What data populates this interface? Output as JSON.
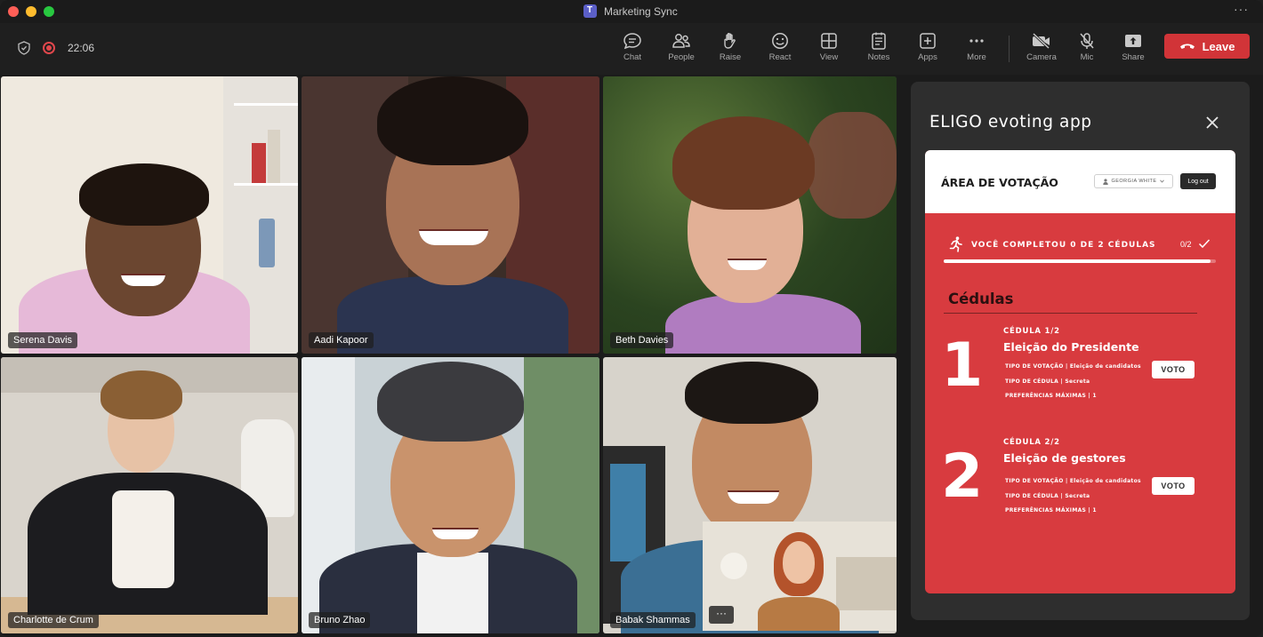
{
  "window": {
    "title": "Marketing Sync",
    "more_label": "···"
  },
  "toolbar": {
    "timer": "22:06",
    "buttons": [
      {
        "label": "Chat",
        "icon": "chat-icon"
      },
      {
        "label": "People",
        "icon": "people-icon"
      },
      {
        "label": "Raise",
        "icon": "raise-hand-icon"
      },
      {
        "label": "React",
        "icon": "react-icon"
      },
      {
        "label": "View",
        "icon": "view-icon"
      },
      {
        "label": "Notes",
        "icon": "notes-icon"
      },
      {
        "label": "Apps",
        "icon": "apps-icon"
      },
      {
        "label": "More",
        "icon": "more-icon"
      },
      {
        "label": "Camera",
        "icon": "camera-off-icon"
      },
      {
        "label": "Mic",
        "icon": "mic-off-icon"
      },
      {
        "label": "Share",
        "icon": "share-icon"
      }
    ],
    "leave_label": "Leave",
    "leave_color": "#d13438"
  },
  "participants": [
    {
      "name": "Serena Davis"
    },
    {
      "name": "Aadi Kapoor"
    },
    {
      "name": "Beth Davies"
    },
    {
      "name": "Charlotte de Crum"
    },
    {
      "name": "Bruno Zhao"
    },
    {
      "name": "Babak Shammas"
    }
  ],
  "tile_more_label": "···",
  "panel": {
    "title": "ELIGO evoting app",
    "app": {
      "header_title": "ÁREA DE VOTAÇÃO",
      "user": "GEORGIA WHITE",
      "logout_label": "Log out",
      "progress_text": "VOCÊ COMPLETOU 0 DE 2 CÉDULAS",
      "progress_count": "0/2",
      "progress_fraction": 0.98,
      "section_title": "Cédulas",
      "accent_color": "#d83b3f",
      "ballots": [
        {
          "number": "1",
          "tag": "CÉDULA 1/2",
          "title": "Eleição do Presidente",
          "vote_type": "TIPO DE VOTAÇÃO | Eleição de candidatos",
          "ballot_type": "TIPO DE CÉDULA | Secreta",
          "max_prefs": "PREFERÊNCIAS MÁXIMAS | 1",
          "vote_label": "VOTO"
        },
        {
          "number": "2",
          "tag": "CÉDULA 2/2",
          "title": "Eleição de gestores",
          "vote_type": "TIPO DE VOTAÇÃO | Eleição de candidatos",
          "ballot_type": "TIPO DE CÉDULA | Secreta",
          "max_prefs": "PREFERÊNCIAS MÁXIMAS | 1",
          "vote_label": "VOTO"
        }
      ]
    }
  }
}
